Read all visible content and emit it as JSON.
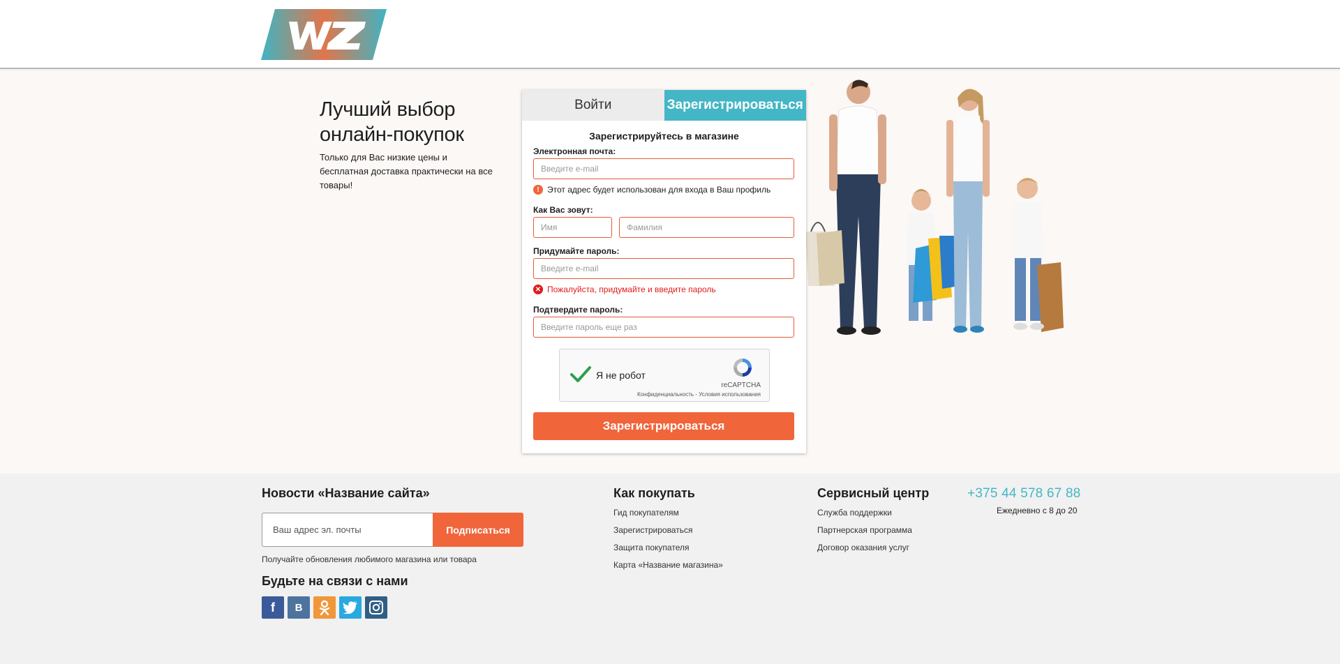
{
  "header": {
    "logo_text": "WZ"
  },
  "promo": {
    "title_line1": "Лучший выбор",
    "title_line2": "онлайн-покупок",
    "text": "Только для Вас низкие цены и бесплатная доставка практически на все товары!"
  },
  "tabs": {
    "login": "Войти",
    "register": "Зарегистрироваться",
    "active": "register"
  },
  "form": {
    "title": "Зарегистрируйтесь в магазине",
    "email_label": "Электронная почта:",
    "email_placeholder": "Введите e-mail",
    "email_hint": "Этот адрес будет использован для входа в Ваш профиль",
    "name_label": "Как Вас зовут:",
    "first_name_placeholder": "Имя",
    "last_name_placeholder": "Фамилия",
    "password_label": "Придумайте пароль:",
    "password_placeholder": "Введите e-mail",
    "password_error": "Пожалуйста, придумайте и введите пароль",
    "confirm_label": "Подтвердите пароль:",
    "confirm_placeholder": "Введите пароль еще раз",
    "submit_label": "Зарегистрироваться"
  },
  "captcha": {
    "label": "Я не робот",
    "brand": "reCAPTCHA",
    "links": "Конфиденциальность - Условия использования",
    "checked": true
  },
  "footer": {
    "news_title": "Новости «Название сайта»",
    "news_placeholder": "Ваш адрес эл. почты",
    "subscribe_label": "Подписаться",
    "news_note": "Получайте обновления любимого магазина или товара",
    "social_title": "Будьте на связи с нами",
    "socials": [
      {
        "name": "facebook-icon",
        "glyph": "f"
      },
      {
        "name": "vk-icon",
        "glyph": "B"
      },
      {
        "name": "odnoklassniki-icon",
        "glyph": "ok"
      },
      {
        "name": "twitter-icon",
        "glyph": "tw"
      },
      {
        "name": "instagram-icon",
        "glyph": "ig"
      }
    ],
    "how_to_buy_title": "Как покупать",
    "how_to_buy": [
      "Гид покупателям",
      "Зарегистрироваться",
      "Защита покупателя",
      "Карта «Название магазина»"
    ],
    "service_title": "Сервисный центр",
    "service": [
      "Служба поддержки",
      "Партнерская программа",
      "Договор оказания услуг"
    ],
    "phone": "+375 44 578 67 88",
    "hours": "Ежедневно с 8 до 20"
  },
  "colors": {
    "accent": "#f0653a",
    "teal": "#44b6c5",
    "error": "#e01a1a"
  }
}
